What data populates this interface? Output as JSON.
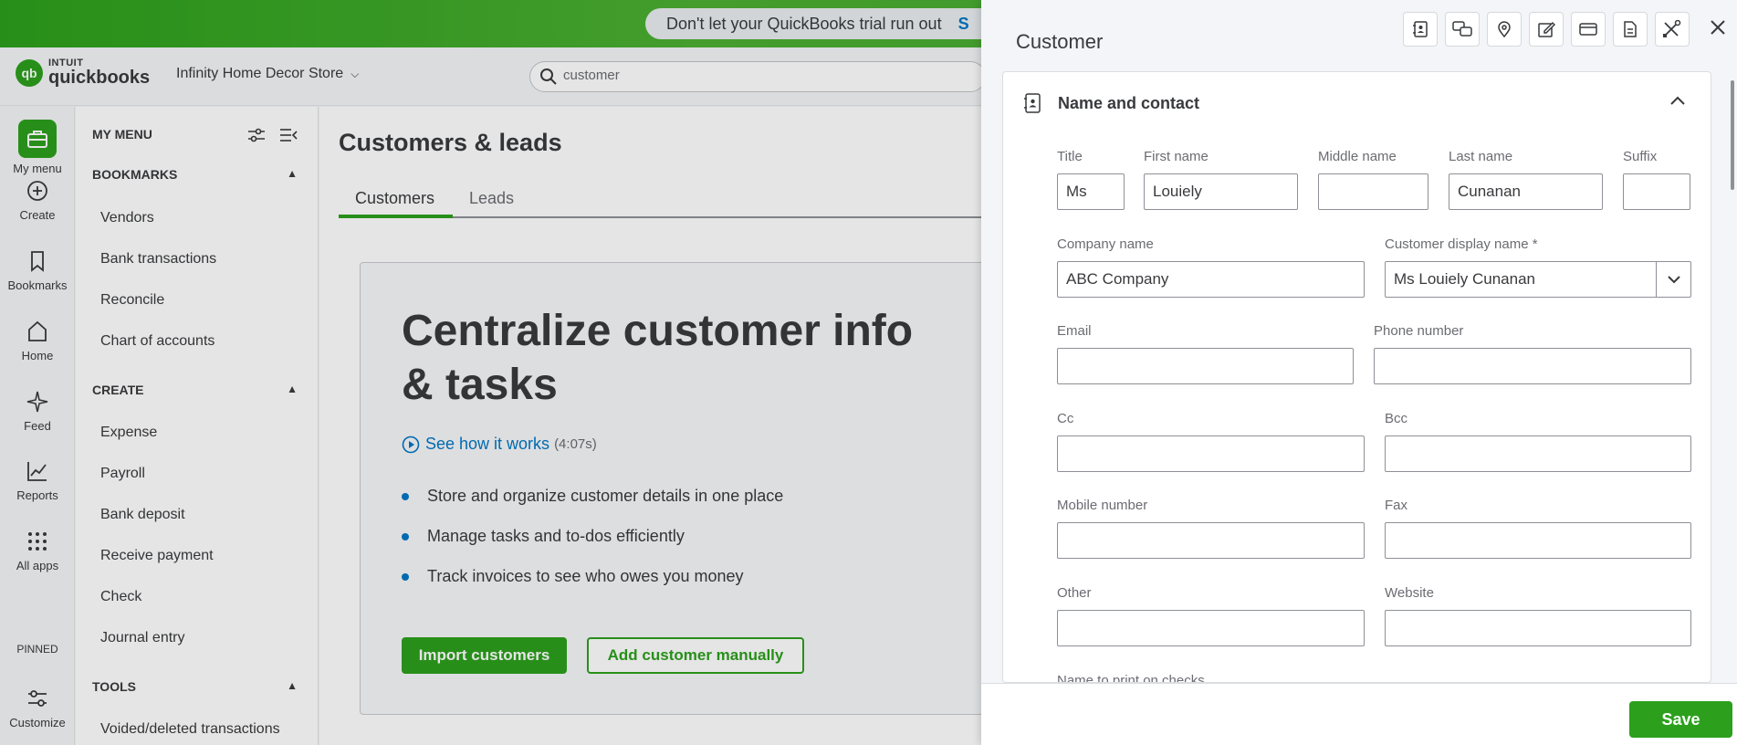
{
  "banner": {
    "trial_text": "Don't let your QuickBooks trial run out",
    "trial_link": "S"
  },
  "header": {
    "logo_intuit": "INTUIT",
    "logo_qb": "quickbooks",
    "logo_mark": "qb",
    "company": "Infinity Home Decor Store",
    "search_value": "customer"
  },
  "rail": {
    "items": [
      {
        "label": "My menu",
        "icon": "briefcase-icon"
      },
      {
        "label": "Create",
        "icon": "plus-circle-icon"
      },
      {
        "label": "Bookmarks",
        "icon": "bookmark-icon"
      },
      {
        "label": "Home",
        "icon": "home-icon"
      },
      {
        "label": "Feed",
        "icon": "sparkle-icon"
      },
      {
        "label": "Reports",
        "icon": "chart-icon"
      },
      {
        "label": "All apps",
        "icon": "grid-icon"
      }
    ],
    "pinned": "PINNED",
    "customize": "Customize"
  },
  "menu": {
    "title": "MY MENU",
    "bookmarks_head": "BOOKMARKS",
    "bookmarks": [
      "Vendors",
      "Bank transactions",
      "Reconcile",
      "Chart of accounts"
    ],
    "create_head": "CREATE",
    "create": [
      "Expense",
      "Payroll",
      "Bank deposit",
      "Receive payment",
      "Check",
      "Journal entry"
    ],
    "tools_head": "TOOLS",
    "tools": [
      "Voided/deleted transactions"
    ]
  },
  "main": {
    "title": "Customers & leads",
    "tabs": [
      "Customers",
      "Leads"
    ],
    "promo_title": "Centralize customer info & tasks",
    "how_link": "See how it works",
    "how_duration": "(4:07s)",
    "bullets": [
      "Store and organize customer details in one place",
      "Manage tasks and to-dos efficiently",
      "Track invoices to see who owes you money"
    ],
    "import_btn": "Import customers",
    "add_btn": "Add customer manually"
  },
  "drawer": {
    "title": "Customer",
    "section": "Name and contact",
    "fields": {
      "title": {
        "label": "Title",
        "value": "Ms"
      },
      "first_name": {
        "label": "First name",
        "value": "Louiely"
      },
      "middle_name": {
        "label": "Middle name",
        "value": ""
      },
      "last_name": {
        "label": "Last name",
        "value": "Cunanan"
      },
      "suffix": {
        "label": "Suffix",
        "value": ""
      },
      "company": {
        "label": "Company name",
        "value": "ABC Company"
      },
      "display_name": {
        "label": "Customer display name *",
        "value": "Ms Louiely Cunanan"
      },
      "email": {
        "label": "Email",
        "value": ""
      },
      "phone": {
        "label": "Phone number",
        "value": ""
      },
      "cc": {
        "label": "Cc",
        "value": ""
      },
      "bcc": {
        "label": "Bcc",
        "value": ""
      },
      "mobile": {
        "label": "Mobile number",
        "value": ""
      },
      "fax": {
        "label": "Fax",
        "value": ""
      },
      "other": {
        "label": "Other",
        "value": ""
      },
      "website": {
        "label": "Website",
        "value": ""
      }
    },
    "cutoff_label": "Name to print on checks",
    "save": "Save"
  },
  "colors": {
    "brand_green": "#2ca01c",
    "link_blue": "#0077c5"
  }
}
